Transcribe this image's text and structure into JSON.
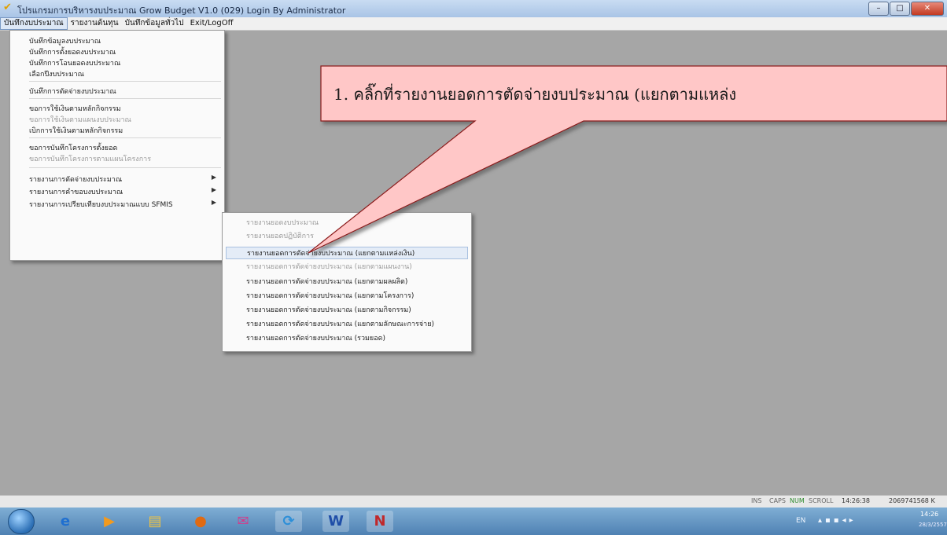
{
  "window": {
    "title": "โปรแกรมการบริหารงบประมาณ Grow Budget V1.0 (029) Login By Administrator",
    "min_label": "–",
    "max_label": "□",
    "close_label": "✕"
  },
  "menubar": {
    "items": [
      "บันทึกงบประมาณ",
      "รายงานต้นทุน",
      "บันทึกข้อมูลทั่วไป",
      "Exit/LogOff"
    ]
  },
  "dropdown": {
    "items": [
      {
        "label": "บันทึกข้อมูลงบประมาณ",
        "disabled": false
      },
      {
        "label": "บันทึกการตั้งยอดงบประมาณ",
        "disabled": false
      },
      {
        "label": "บันทึกการโอนยอดงบประมาณ",
        "disabled": false
      },
      {
        "label": "เลือกปีงบประมาณ",
        "disabled": false
      },
      {
        "label": "บันทึกการตัดจ่ายงบประมาณ",
        "disabled": false
      },
      {
        "label": "ขอการใช้เงินตามหลักกิจกรรม",
        "disabled": false
      },
      {
        "label": "ขอการใช้เงินตามแผนงบประมาณ",
        "disabled": true
      },
      {
        "label": "เบิกการใช้เงินตามหลักกิจกรรม",
        "disabled": false
      },
      {
        "label": "ขอการบันทึกโครงการตั้งยอด",
        "disabled": false
      },
      {
        "label": "ขอการบันทึกโครงการตามแผนโครงการ",
        "disabled": true
      },
      {
        "label": "รายงานการตัดจ่ายงบประมาณ",
        "disabled": false
      },
      {
        "label": "รายงานการคำขอบงบประมาณ",
        "disabled": false
      },
      {
        "label": "รายงานการเปรียบเทียบงบประมาณแบบ SFMIS",
        "disabled": false
      }
    ],
    "arrow": "▶"
  },
  "submenu": {
    "items": [
      {
        "label": "รายงานยอดงบประมาณ",
        "disabled": true
      },
      {
        "label": "รายงานยอดปฏิบัติการ",
        "disabled": true
      },
      {
        "label": "รายงานยอดการตัดจ่ายงบประมาณ (แยกตามแหล่งเงิน)",
        "disabled": false
      },
      {
        "label": "รายงานยอดการตัดจ่ายงบประมาณ (แยกตามแผนงาน)",
        "disabled": true
      },
      {
        "label": "รายงานยอดการตัดจ่ายงบประมาณ (แยกตามผลผลิต)",
        "disabled": false
      },
      {
        "label": "รายงานยอดการตัดจ่ายงบประมาณ (แยกตามโครงการ)",
        "disabled": false
      },
      {
        "label": "รายงานยอดการตัดจ่ายงบประมาณ (แยกตามกิจกรรม)",
        "disabled": false
      },
      {
        "label": "รายงานยอดการตัดจ่ายงบประมาณ (แยกตามลักษณะการจ่าย)",
        "disabled": false
      },
      {
        "label": "รายงานยอดการตัดจ่ายงบประมาณ (รวมยอด)",
        "disabled": false
      }
    ]
  },
  "callout": {
    "text": "1. คลิ๊กที่รายงานยอดการตัดจ่ายงบประมาณ (แยกตามแหล่ง",
    "fill": "#ffc7c7",
    "stroke": "#8b1a1a"
  },
  "statusbar": {
    "ins": "INS",
    "caps": "CAPS",
    "num": "NUM",
    "scroll": "SCROLL",
    "clock": "14:26:38",
    "extra": "2069741568 K"
  },
  "taskbar": {
    "lang": "EN",
    "time": "14:26",
    "date": "28/3/2557"
  },
  "icons": {
    "app": "app-logo-icon",
    "ie": "internet-explorer-icon",
    "media": "media-player-icon",
    "folder": "folder-icon",
    "firefox": "firefox-icon",
    "mail": "mail-icon",
    "refresh": "refresh-icon",
    "word": "word-icon",
    "app2": "growbudget-icon"
  }
}
